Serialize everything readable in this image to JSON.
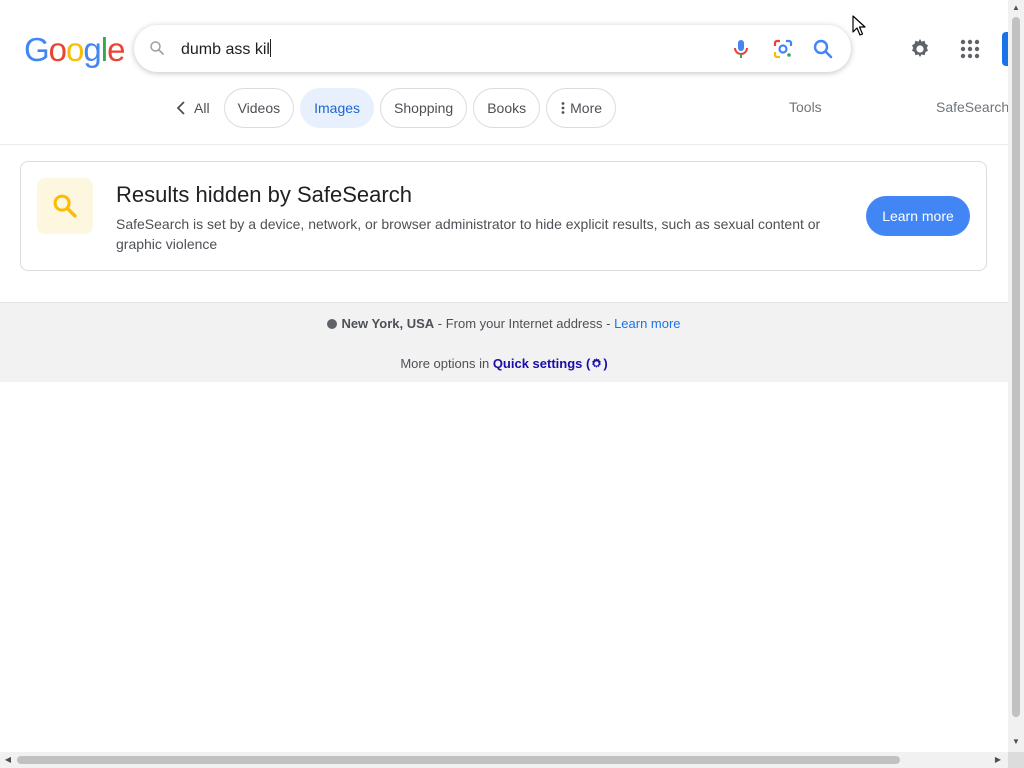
{
  "logo": {
    "letters": [
      "G",
      "o",
      "o",
      "g",
      "l",
      "e"
    ],
    "colors": [
      "#4285f4",
      "#ea4335",
      "#fbbc05",
      "#4285f4",
      "#34a853",
      "#ea4335"
    ]
  },
  "search": {
    "query": "dumb ass kil"
  },
  "tabs": {
    "all_label": "All",
    "chips": [
      {
        "label": "Videos",
        "active": false
      },
      {
        "label": "Images",
        "active": true
      },
      {
        "label": "Shopping",
        "active": false
      },
      {
        "label": "Books",
        "active": false
      },
      {
        "label": "More",
        "active": false
      }
    ],
    "tools_label": "Tools",
    "safesearch_label": "SafeSearch"
  },
  "safesearch_card": {
    "title": "Results hidden by SafeSearch",
    "description": "SafeSearch is set by a device, network, or browser administrator to hide explicit results, such as sexual content or graphic violence",
    "button_label": "Learn more"
  },
  "footer": {
    "location": "New York, USA",
    "location_source": " - From your Internet address - ",
    "location_link": "Learn more",
    "quick_settings_prefix": "More options in ",
    "quick_settings_link": "Quick settings (",
    "quick_settings_suffix": ")"
  },
  "colors": {
    "accent_blue": "#4285f4",
    "link_blue": "#1a73e8",
    "active_chip_bg": "#e8f0fe",
    "safesearch_icon": "#fbbc04"
  }
}
